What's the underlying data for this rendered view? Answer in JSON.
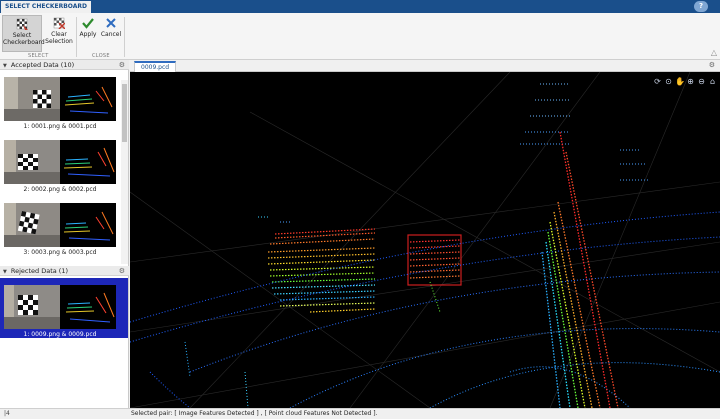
{
  "app": {
    "tab_label": "SELECT CHECKERBOARD",
    "help_label": "?"
  },
  "ribbon": {
    "buttons": [
      {
        "label_line1": "Select",
        "label_line2": "Checkerboard",
        "icon": "checkerboard-icon"
      },
      {
        "label_line1": "Clear",
        "label_line2": "Selection",
        "icon": "clear-checkerboard-icon"
      },
      {
        "label_line1": "Apply",
        "icon": "checkmark-icon"
      },
      {
        "label_line1": "Cancel",
        "icon": "x-icon"
      }
    ],
    "groups": [
      "SELECT",
      "CLOSE"
    ]
  },
  "accepted": {
    "title": "Accepted Data (10)",
    "items": [
      {
        "caption": "1: 0001.png & 0001.pcd"
      },
      {
        "caption": "2: 0002.png & 0002.pcd"
      },
      {
        "caption": "3: 0003.png & 0003.pcd"
      }
    ]
  },
  "rejected": {
    "title": "Rejected Data (1)",
    "items": [
      {
        "caption": "1: 0009.png & 0009.pcd"
      }
    ]
  },
  "viewer": {
    "tab_label": "0009.pcd",
    "tools": [
      "rotate-icon",
      "rotate-3d-icon",
      "pan-icon",
      "zoom-in-icon",
      "zoom-out-icon",
      "restore-view-icon"
    ]
  },
  "status": {
    "left": "|4",
    "message": "Selected pair: [ Image Features Detected ] , [ Point cloud Features Not Detected ]."
  },
  "colors": {
    "brand": "#1a4f8b",
    "selection": "#1d27b8",
    "roi": "#cc1f1f"
  }
}
